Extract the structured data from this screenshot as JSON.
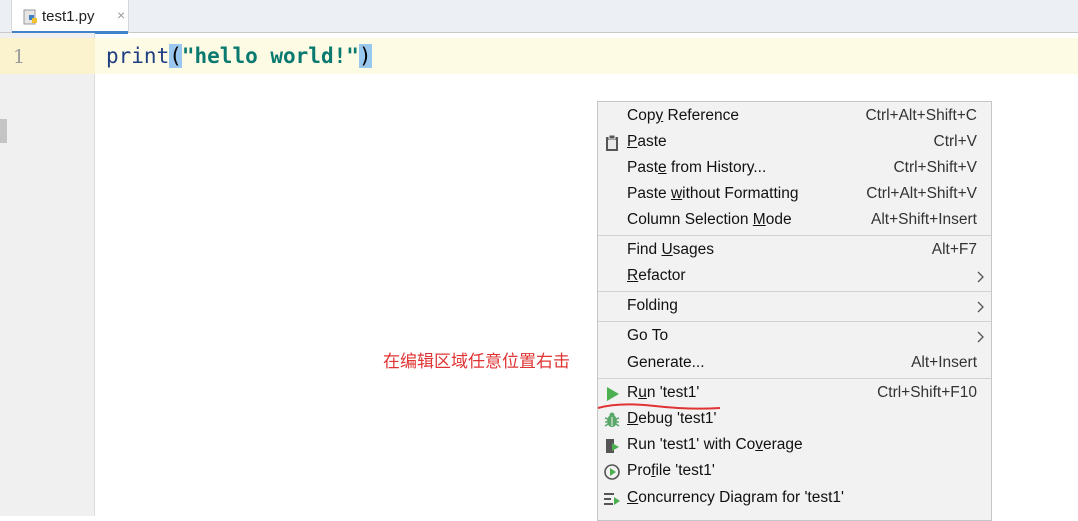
{
  "tab": {
    "title": "test1.py",
    "close": "×"
  },
  "editor": {
    "line_number": "1",
    "code": {
      "fn": "print",
      "open": "(",
      "string": "\"hello world!\"",
      "close": ")"
    }
  },
  "annotation": "在编辑区域任意位置右击",
  "context_menu": {
    "items": [
      {
        "label": "Copy Reference",
        "shortcut": "Ctrl+Alt+Shift+C"
      },
      {
        "label": "Paste",
        "shortcut": "Ctrl+V",
        "icon": "clipboard-icon"
      },
      {
        "label": "Paste from History...",
        "shortcut": "Ctrl+Shift+V"
      },
      {
        "label": "Paste without Formatting",
        "shortcut": "Ctrl+Alt+Shift+V"
      },
      {
        "label": "Column Selection Mode",
        "shortcut": "Alt+Shift+Insert"
      },
      {
        "label": "Find Usages",
        "shortcut": "Alt+F7"
      },
      {
        "label": "Refactor",
        "submenu": true
      },
      {
        "label": "Folding",
        "submenu": true
      },
      {
        "label": "Go To",
        "submenu": true
      },
      {
        "label": "Generate...",
        "shortcut": "Alt+Insert"
      },
      {
        "label": "Run 'test1'",
        "shortcut": "Ctrl+Shift+F10",
        "icon": "run-icon"
      },
      {
        "label": "Debug 'test1'",
        "icon": "debug-icon"
      },
      {
        "label": "Run 'test1' with Coverage",
        "icon": "coverage-icon"
      },
      {
        "label": "Profile 'test1'",
        "icon": "profile-icon"
      },
      {
        "label": "Concurrency Diagram for 'test1'",
        "icon": "concurrency-icon"
      }
    ]
  },
  "colors": {
    "accent": "#4083c9",
    "run_green": "#4caf50",
    "annotation_red": "#e03434"
  }
}
